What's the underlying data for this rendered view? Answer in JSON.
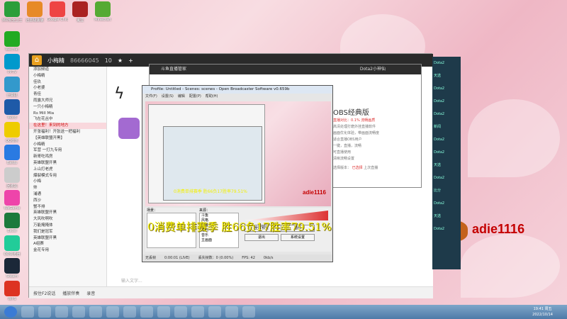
{
  "desktop_icons_top": [
    {
      "label": "360安全卫士",
      "color": "#2b9e3a"
    },
    {
      "label": "迅雷极速版",
      "color": "#e78a27"
    },
    {
      "label": "Google Chrome",
      "color": "#e44"
    },
    {
      "label": "鬼泣",
      "color": "#a22"
    },
    {
      "label": "Minecraft",
      "color": "#5a3"
    }
  ],
  "desktop_icons_left": [
    {
      "label": "Wechat",
      "color": "#2a2"
    },
    {
      "label": "PPTV",
      "color": "#09c"
    },
    {
      "label": "计算机",
      "color": "#39c"
    },
    {
      "label": "Word",
      "color": "#1e5aa8"
    },
    {
      "label": "QQ音乐",
      "color": "#ec0"
    },
    {
      "label": "Baidu",
      "color": "#2a7ae2"
    },
    {
      "label": "回收站",
      "color": "#ccc"
    },
    {
      "label": "WeGame",
      "color": "#e4a"
    },
    {
      "label": "Excel",
      "color": "#1d7a3c"
    },
    {
      "label": "QQ浏览器",
      "color": "#2c9"
    },
    {
      "label": "Steam",
      "color": "#1b2838"
    },
    {
      "label": "WPS",
      "color": "#d32"
    }
  ],
  "chat_app": {
    "user": "小梅精",
    "id": "86666045",
    "level": "10",
    "sidebar": [
      "添加频道",
      "小梅精",
      "佳玖",
      "小老婆",
      "青佳",
      "雨露大师兄",
      "一只小梅精",
      "Rs Mill Mia",
      "飞在花丛中",
      "在这里！来到的地方",
      "开张福利！开张送一把福利",
      "【英雄联盟开黑】",
      "小梅精",
      "军营 一打九专用",
      "新哥吃鸡房",
      "英雄联盟开黑",
      "上山打老虎",
      "爆裂模式专用",
      "小梅",
      "帅",
      "浦通",
      "西沙",
      "蟹不排",
      "英雄联盟开黑",
      "大风吹啊吹",
      "万能掩掩体",
      "我们是冠军",
      "英雄联盟开黑",
      "A组赛",
      "金花专用"
    ],
    "bottom_bar": [
      "按住F2说话",
      "播放伴奏",
      "录音"
    ],
    "input_placeholder": "输入文字..."
  },
  "stream_manager": {
    "title": "斗鱼直播管家",
    "top_right_label": "Dota2小神仙"
  },
  "obs_info": {
    "title": "OBS经典版",
    "line_red": "直播对比：0.1% 流畅画质",
    "desc": [
      "高清处理打磨外挂直播软件",
      "画面优化体验，带画面流畅度",
      "适合直播OBS用户",
      "一键，直播，流畅",
      "可直播使用",
      "清晰流畅设置"
    ],
    "version_label": "选择版本：",
    "option_a": "已选择",
    "option_b": "上次直播"
  },
  "obs": {
    "title": "Profile: Untitled - Scenes: scenes - Open Broadcaster Software v0.659b",
    "menu": [
      "文件(F)",
      "设置(S)",
      "编辑",
      "配置(P)",
      "帮助(H)"
    ],
    "scene_label": "场景：",
    "source_label": "来源：",
    "sources": [
      "斗鱼",
      "风格",
      "屏幕",
      "福利",
      "音乐",
      "主画面"
    ],
    "buttons": [
      "全屏预览",
      "插件",
      "退出",
      "系统设置"
    ],
    "status": [
      "无丢帧",
      "0:00:01 (LIVE)",
      "丢失帧数：0 (0.00%)",
      "FPS: 42",
      "0kb/s"
    ],
    "preview_name": "adie1116",
    "preview_overlay": "0消费单排赛季 胜66负17胜率79.51%"
  },
  "overlay": {
    "text": "0消费单排赛季 胜66负17胜率79.51%",
    "gift_user": "adie1116"
  },
  "right_panel": [
    "Dota2",
    "天选",
    "Dota2",
    "Dota2",
    "Dota2",
    "新闻",
    "Dota2",
    "Dota2",
    "天选",
    "Dota2",
    "比分",
    "Dota2",
    "天选",
    "Dota2"
  ],
  "taskbar": {
    "time": "19:41 周五",
    "date": "2022/10/14"
  },
  "colors": {
    "overlay_yellow": "#f4f000",
    "gift_red": "#c40000",
    "titlebar_dark": "#2a2a2a"
  }
}
